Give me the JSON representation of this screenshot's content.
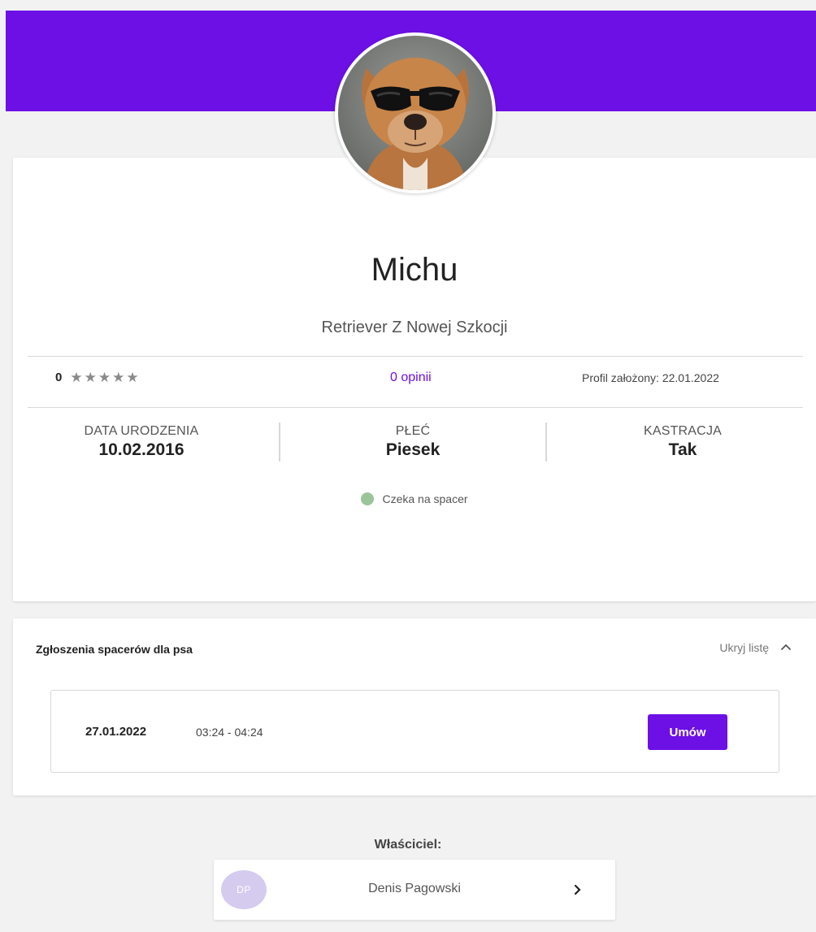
{
  "profile": {
    "name": "Michu",
    "breed": "Retriever Z Nowej Szkocji",
    "rating_value": "0",
    "stars": 5,
    "reviews_link": "0 opinii",
    "created": "Profil założony: 22.01.2022",
    "attributes": [
      {
        "label": "DATA URODZENIA",
        "value": "10.02.2016"
      },
      {
        "label": "PŁEĆ",
        "value": "Piesek"
      },
      {
        "label": "KASTRACJA",
        "value": "Tak"
      }
    ],
    "status": "Czeka na spacer"
  },
  "walks": {
    "title": "Zgłoszenia spacerów dla psa",
    "toggle_label": "Ukryj listę",
    "items": [
      {
        "date": "27.01.2022",
        "time": "03:24 - 04:24",
        "button": "Umów"
      }
    ]
  },
  "owner": {
    "label": "Właściciel:",
    "initials": "DP",
    "name": "Denis Pagowski"
  },
  "colors": {
    "accent": "#6d10e6",
    "status_dot": "#9bc49b",
    "avatar_bg": "#d4cbee"
  }
}
